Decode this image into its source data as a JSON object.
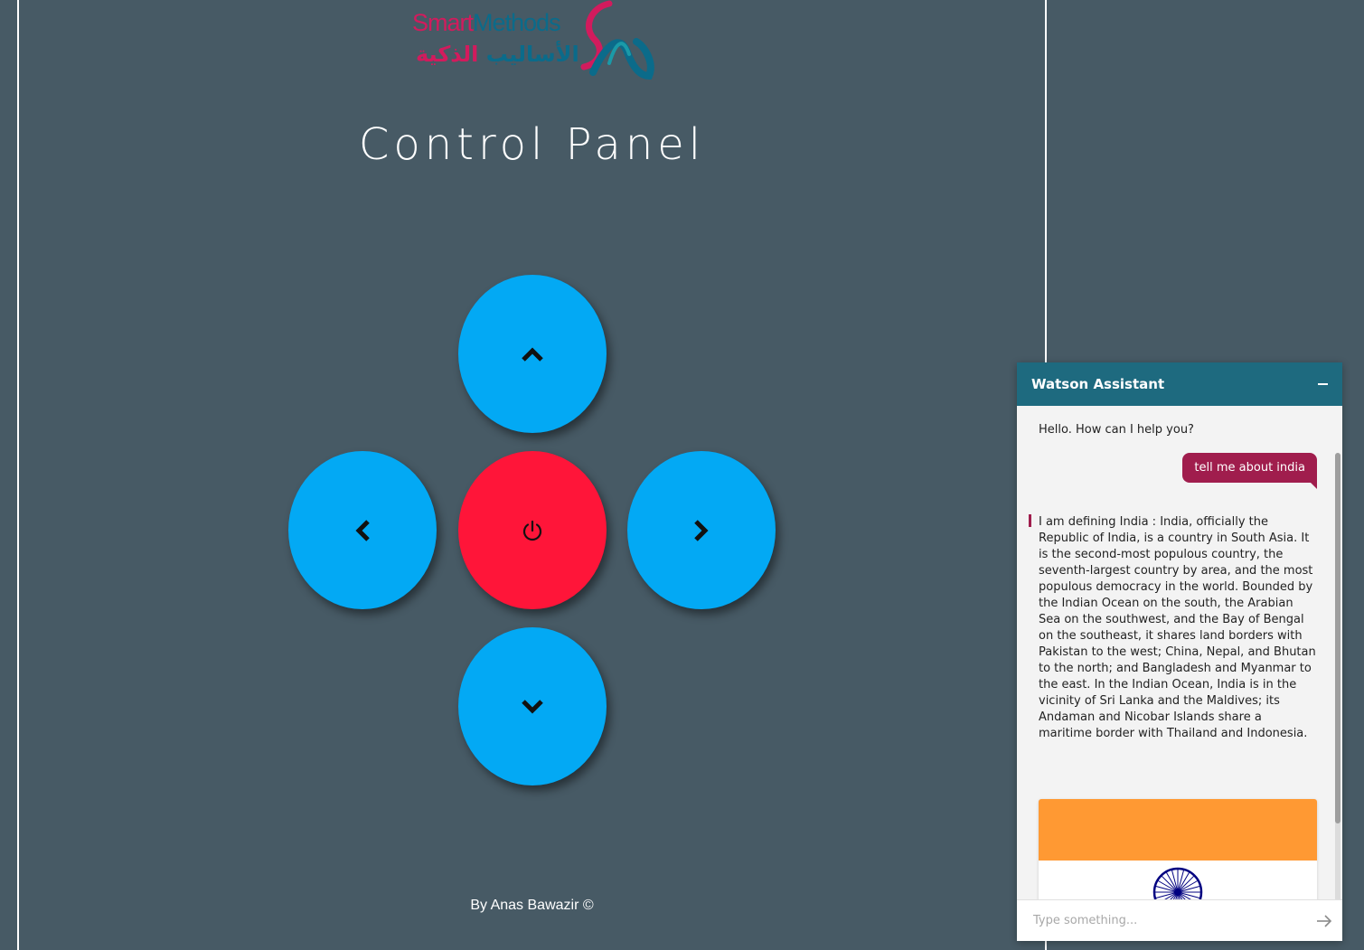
{
  "logo": {
    "text_smart": "Smart",
    "text_methods": "Methods",
    "text_arabic_1": "الأساليب",
    "text_arabic_2": "الذكية"
  },
  "title": "Control Panel",
  "controls": {
    "up_icon": "chevron-up-icon",
    "left_icon": "chevron-left-icon",
    "power_icon": "power-icon",
    "right_icon": "chevron-right-icon",
    "down_icon": "chevron-down-icon",
    "direction_color": "#03a9f4",
    "power_color": "#ff1539"
  },
  "footer": "By Anas Bawazir ©",
  "chat": {
    "title": "Watson Assistant",
    "header_color": "#1e6a7f",
    "messages": [
      {
        "from": "bot",
        "text": "Hello. How can I help you?"
      },
      {
        "from": "user",
        "text": "tell me about india"
      },
      {
        "from": "bot",
        "text": "I am defining India : India, officially the Republic of India, is a country in South Asia. It is the second-most populous country, the seventh-largest country by area, and the most populous democracy in the world. Bounded by the Indian Ocean on the south, the Arabian Sea on the southwest, and the Bay of Bengal on the southeast, it shares land borders with Pakistan to the west; China, Nepal, and Bhutan to the north; and Bangladesh and Myanmar to the east. In the Indian Ocean, India is in the vicinity of Sri Lanka and the Maldives; its Andaman and Nicobar Islands share a maritime border with Thailand and Indonesia."
      }
    ],
    "input_placeholder": "Type something...",
    "user_bubble_color": "#a01d4d"
  }
}
